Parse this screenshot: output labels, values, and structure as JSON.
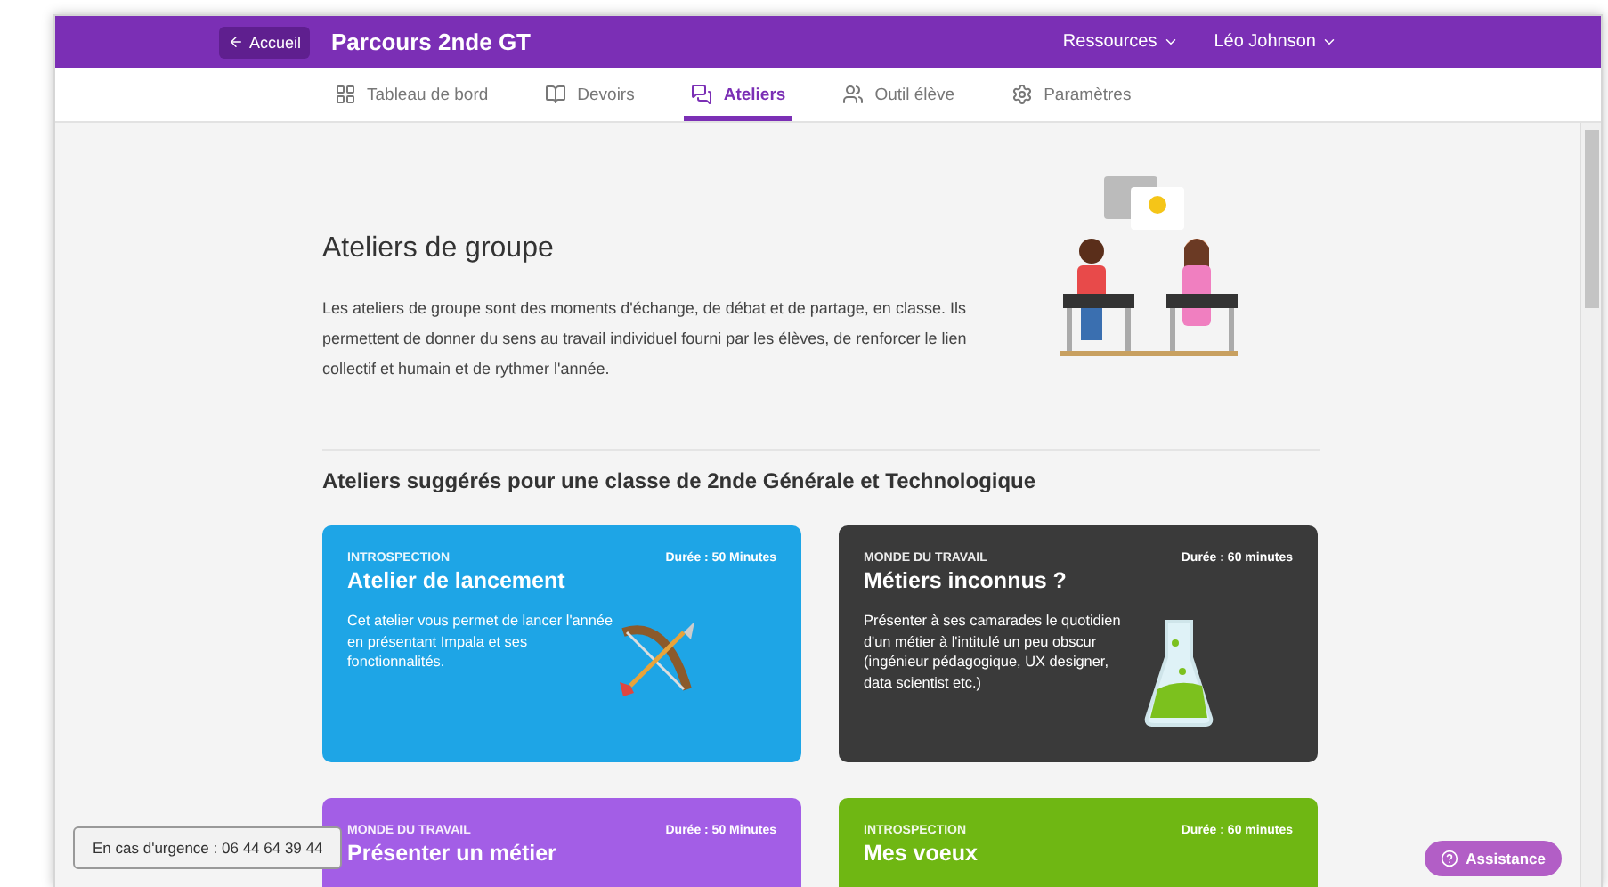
{
  "header": {
    "back_button": "Accueil",
    "title": "Parcours 2nde GT",
    "menus": [
      "Ressources",
      "Léo Johnson"
    ]
  },
  "tabs": [
    {
      "label": "Tableau de bord",
      "selected": false
    },
    {
      "label": "Devoirs",
      "selected": false
    },
    {
      "label": "Ateliers",
      "selected": true
    },
    {
      "label": "Outil élève",
      "selected": false
    },
    {
      "label": "Paramètres",
      "selected": false
    }
  ],
  "intro": {
    "title": "Ateliers de groupe",
    "text": "Les ateliers de groupe sont des moments d'échange, de débat et de partage, en classe. Ils permettent de donner du sens au travail individuel fourni par les élèves, de renforcer le lien collectif et humain et de rythmer l'année."
  },
  "section_title": "Ateliers suggérés pour une classe de 2nde Générale et Technologique",
  "cards": [
    {
      "kind": "bow",
      "color": "#1ea5e6",
      "category": "INTROSPECTION",
      "duration": "Durée : 50 Minutes",
      "title": "Atelier de lancement",
      "description": "Cet atelier vous permet de lancer l'année en présentant Impala et ses fonctionnalités."
    },
    {
      "kind": "flask",
      "color": "#3a3a3a",
      "category": "MONDE DU TRAVAIL",
      "duration": "Durée : 60 minutes",
      "title": "Métiers inconnus ?",
      "description": "Présenter à ses camarades le quotidien d'un métier à l'intitulé un peu obscur (ingénieur pédagogique, UX designer, data scientist etc.)"
    },
    {
      "kind": "none",
      "color": "#a35ee6",
      "category": "MONDE DU TRAVAIL",
      "duration": "Durée : 50 Minutes",
      "title": "Présenter un métier"
    },
    {
      "kind": "none",
      "color": "#6fb713",
      "category": "INTROSPECTION",
      "duration": "Durée : 60 minutes",
      "title": "Mes voeux"
    }
  ],
  "emergency": "En cas d'urgence : 06 44 64 39 44",
  "assistance_button": "Assistance"
}
